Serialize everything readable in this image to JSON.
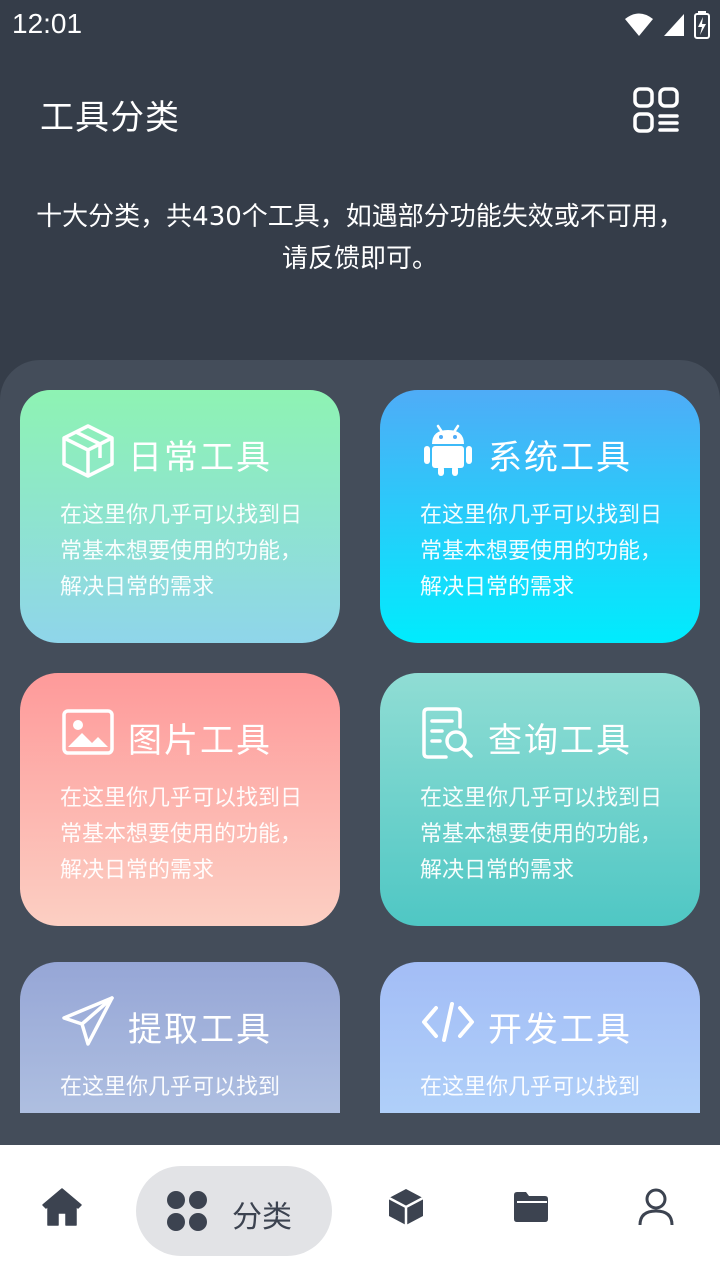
{
  "status_bar": {
    "time": "12:01",
    "icons": [
      "wifi-icon",
      "signal-icon",
      "battery-icon"
    ]
  },
  "header": {
    "title": "工具分类",
    "menu_icon": "grid-menu-icon"
  },
  "description": "十大分类，共430个工具，如遇部分功能失效或不可用，请反馈即可。",
  "categories": [
    {
      "title": "日常工具",
      "desc": "在这里你几乎可以找到日常基本想要使用的功能，解决日常的需求",
      "icon": "cube-icon"
    },
    {
      "title": "系统工具",
      "desc": "在这里你几乎可以找到日常基本想要使用的功能，解决日常的需求",
      "icon": "android-icon"
    },
    {
      "title": "图片工具",
      "desc": "在这里你几乎可以找到日常基本想要使用的功能，解决日常的需求",
      "icon": "image-icon"
    },
    {
      "title": "查询工具",
      "desc": "在这里你几乎可以找到日常基本想要使用的功能，解决日常的需求",
      "icon": "document-search-icon"
    },
    {
      "title": "提取工具",
      "desc": "在这里你几乎可以找到",
      "icon": "paper-plane-icon"
    },
    {
      "title": "开发工具",
      "desc": "在这里你几乎可以找到",
      "icon": "code-icon"
    }
  ],
  "bottom_nav": {
    "items": [
      {
        "icon": "home-icon",
        "label": ""
      },
      {
        "icon": "category-grid-icon",
        "label": "分类",
        "active": true
      },
      {
        "icon": "box-icon",
        "label": ""
      },
      {
        "icon": "folder-icon",
        "label": ""
      },
      {
        "icon": "user-icon",
        "label": ""
      }
    ]
  },
  "colors": {
    "background": "#353d49",
    "panel": "#444d5a",
    "nav_background": "#ffffff",
    "nav_active_pill": "#e2e3e6",
    "nav_icon": "#3c4350"
  }
}
